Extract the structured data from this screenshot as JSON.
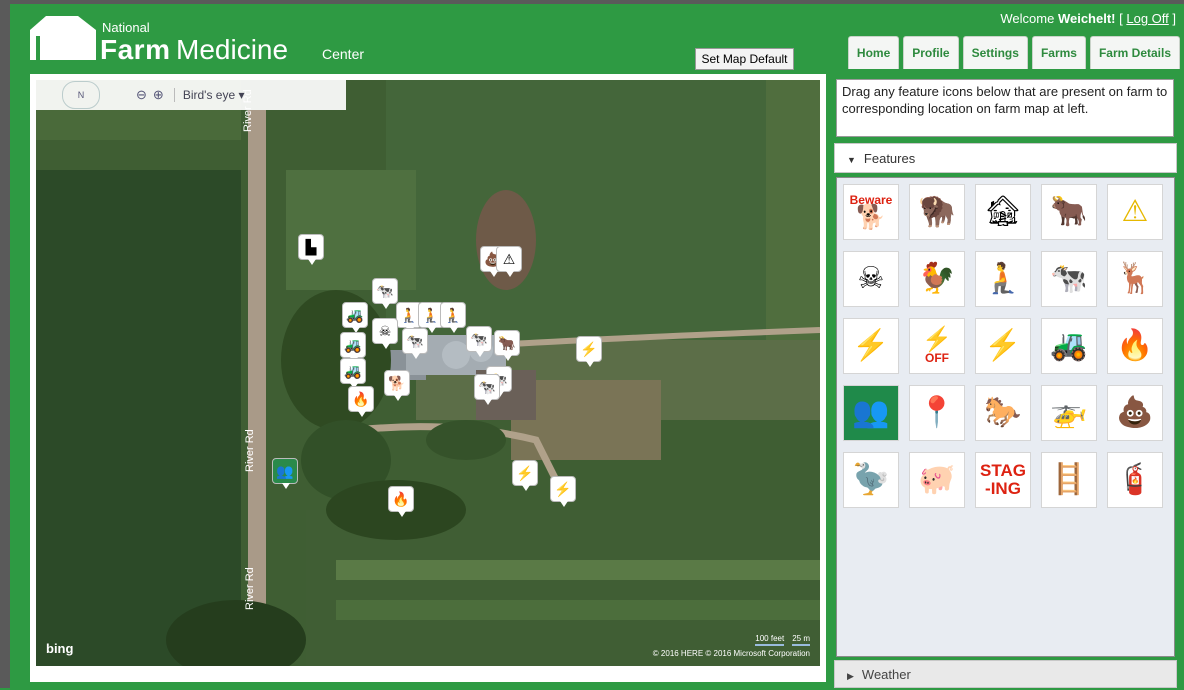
{
  "header": {
    "logo_national": "National",
    "logo_farm": "Farm",
    "logo_medicine": "Medicine",
    "logo_center": "Center",
    "welcome_prefix": "Welcome ",
    "username": "Weichelt!",
    "logoff_label": "Log Off",
    "set_map_default_label": "Set Map Default"
  },
  "nav": {
    "tabs": [
      "Home",
      "Profile",
      "Settings",
      "Farms",
      "Farm Details"
    ]
  },
  "map": {
    "compass_label": "N",
    "zoom_out": "⊖",
    "zoom_in": "⊕",
    "view_mode": "Bird's eye ▾",
    "road_label_top": "River Rd",
    "road_label_mid": "River Rd",
    "road_label_bottom": "River Rd",
    "bing_label": "bing",
    "copyright": "© 2016 HERE   © 2016 Microsoft Corporation",
    "scale_feet": "100 feet",
    "scale_m": "25 m"
  },
  "panel": {
    "instructions": "Drag any feature icons below that are present on farm to corresponding location on farm map at left.",
    "features_label": "Features",
    "weather_label": "Weather",
    "icons": [
      {
        "name": "beware-dog-icon",
        "glyph": "🐕",
        "label": "Beware"
      },
      {
        "name": "bison-icon",
        "glyph": "🦬"
      },
      {
        "name": "barn-icon",
        "glyph": "🏚"
      },
      {
        "name": "bull-icon",
        "glyph": "🐂"
      },
      {
        "name": "warning-icon",
        "glyph": "⚠"
      },
      {
        "name": "poison-icon",
        "glyph": "☠"
      },
      {
        "name": "chicken-icon",
        "glyph": "🐓"
      },
      {
        "name": "confined-space-icon",
        "glyph": "🧎"
      },
      {
        "name": "cow-icon",
        "glyph": "🐄"
      },
      {
        "name": "deer-icon",
        "glyph": "🦌"
      },
      {
        "name": "power-line-icon",
        "glyph": "⚡"
      },
      {
        "name": "power-off-icon",
        "glyph": "⚡",
        "label": "OFF"
      },
      {
        "name": "electric-hazard-icon",
        "glyph": "⚡"
      },
      {
        "name": "tractor-icon",
        "glyph": "🚜"
      },
      {
        "name": "fire-icon",
        "glyph": "🔥"
      },
      {
        "name": "assembly-point-icon",
        "glyph": "👥"
      },
      {
        "name": "location-marker-icon",
        "glyph": "📍"
      },
      {
        "name": "horse-icon",
        "glyph": "🐎"
      },
      {
        "name": "helicopter-icon",
        "glyph": "🚁"
      },
      {
        "name": "manure-icon",
        "glyph": "💩"
      },
      {
        "name": "ostrich-icon",
        "glyph": "🦤"
      },
      {
        "name": "pig-icon",
        "glyph": "🐖"
      },
      {
        "name": "staging-icon",
        "glyph": "",
        "label": "STAG -ING"
      },
      {
        "name": "grain-bin-ladder-icon",
        "glyph": "🪜"
      },
      {
        "name": "fire-hydrant-icon",
        "glyph": "🧯"
      }
    ]
  }
}
